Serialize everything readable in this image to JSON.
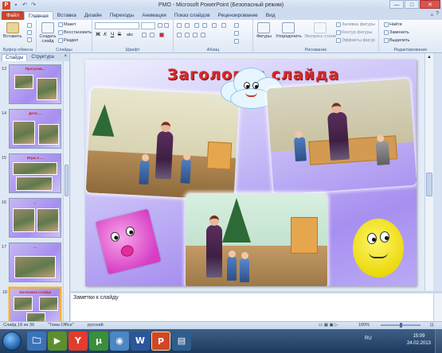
{
  "window": {
    "title": "PMO - Microsoft PowerPoint (Безопасный режим)",
    "app_icon": "P",
    "qat_icons": [
      "save-icon",
      "undo-icon",
      "redo-icon"
    ],
    "controls": {
      "minimize": "—",
      "maximize": "□",
      "close": "✕"
    }
  },
  "ribbon_tabs": {
    "file": "Файл",
    "tabs": [
      "Главная",
      "Вставка",
      "Дизайн",
      "Переходы",
      "Анимация",
      "Показ слайдов",
      "Рецензирование",
      "Вид"
    ],
    "active": "Главная"
  },
  "ribbon": {
    "clipboard": {
      "paste": "Вставить",
      "group": "Буфер обмена"
    },
    "slides": {
      "new_slide": "Создать слайд",
      "layout": "Макет",
      "reset": "Восстановить",
      "section": "Раздел",
      "group": "Слайды"
    },
    "font": {
      "group": "Шрифт",
      "bold": "Ж",
      "italic": "К",
      "underline": "Ч",
      "strike": "S",
      "shadow": "abc"
    },
    "paragraph": {
      "group": "Абзац"
    },
    "drawing": {
      "shapes": "Фигуры",
      "arrange": "Упорядочить",
      "quick_styles": "Экспресс-стили",
      "fill": "Заливка фигуры",
      "outline": "Контур фигуры",
      "effects": "Эффекты фигур",
      "group": "Рисование"
    },
    "editing": {
      "find": "Найти",
      "replace": "Заменить",
      "select": "Выделить",
      "group": "Редактирование"
    }
  },
  "left_panel": {
    "tabs": [
      "Слайды",
      "Структура"
    ],
    "active": "Слайды",
    "close": "×",
    "thumbnails": [
      {
        "number": "13",
        "title": "Прогулки...",
        "selected": false
      },
      {
        "number": "14",
        "title": "Дети ...",
        "selected": false
      },
      {
        "number": "15",
        "title": "Игры с ...",
        "selected": false
      },
      {
        "number": "16",
        "title": "...",
        "selected": false
      },
      {
        "number": "17",
        "title": "...",
        "selected": false
      },
      {
        "number": "18",
        "title": "Заголовок слайда",
        "selected": true
      }
    ]
  },
  "slide": {
    "title": "Заголовок слайда"
  },
  "notes": {
    "placeholder": "Заметки к слайду"
  },
  "status": {
    "slide_info": "Слайд 18 из 39",
    "theme": "\"Тема Office\"",
    "language": "русский",
    "zoom": "100%"
  },
  "taskbar": {
    "apps": [
      {
        "name": "word",
        "letter": "W",
        "color": "#2b579a"
      },
      {
        "name": "powerpoint",
        "letter": "P",
        "color": "#d24726"
      }
    ],
    "language": "RU",
    "time": "15:09",
    "date": "24.02.2013"
  }
}
